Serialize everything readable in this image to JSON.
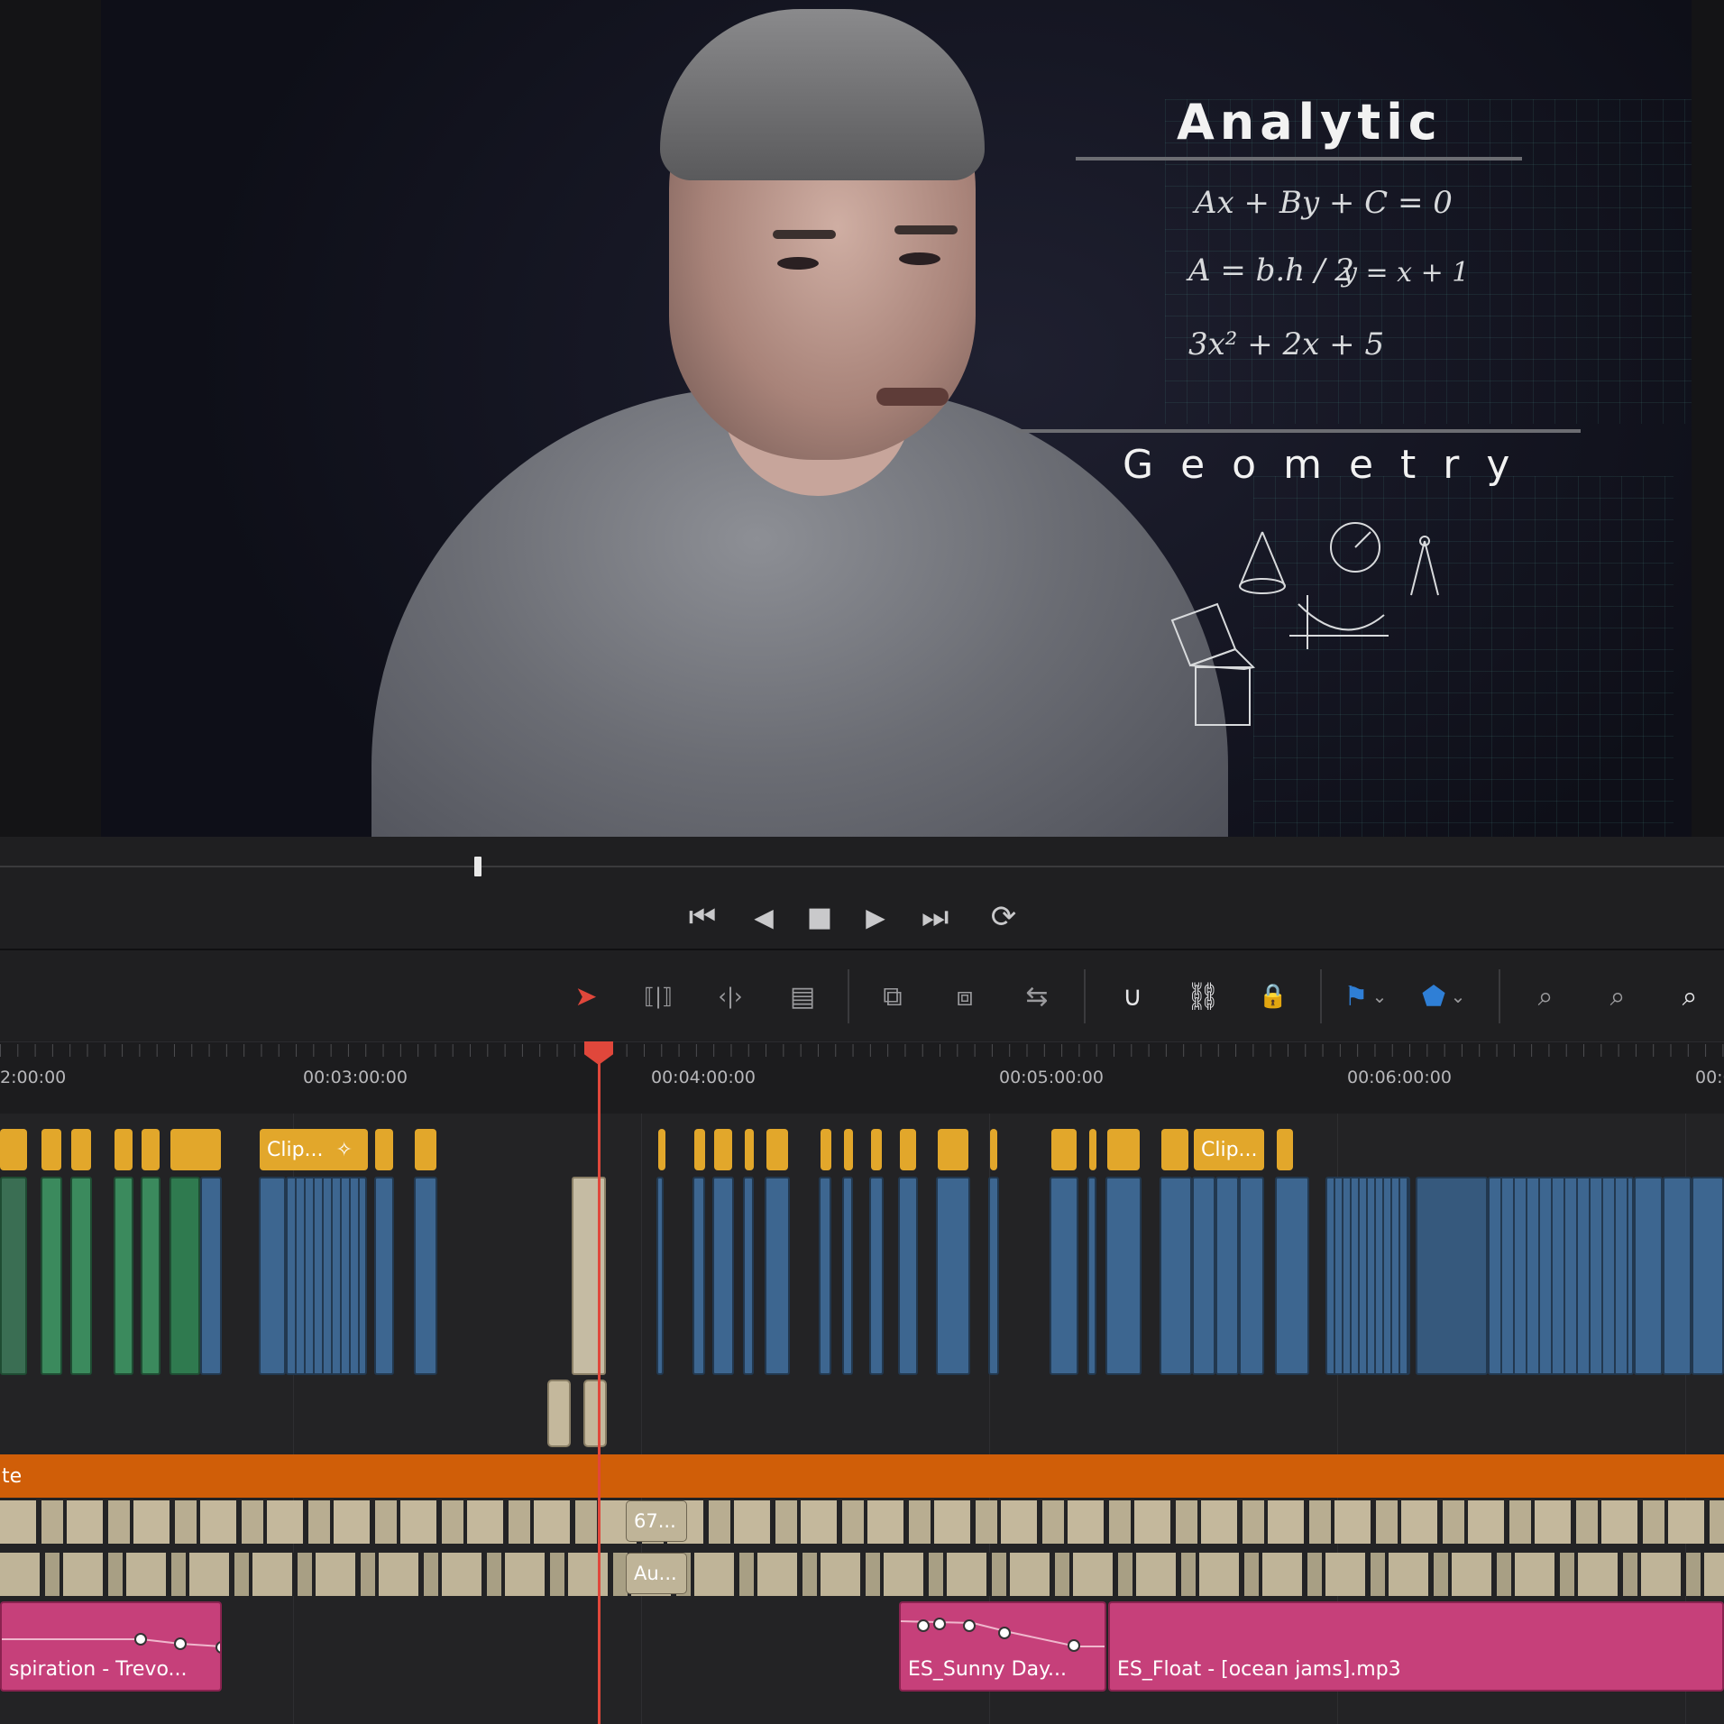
{
  "viewer": {
    "board": {
      "title_top": "Analytic",
      "title_bottom": "Geometry",
      "formulas": [
        "Ax + By + C = 0",
        "A = b.h / 2",
        "y = x + 1",
        "3x² + 2x + 5"
      ]
    }
  },
  "transport": {
    "buttons": [
      {
        "name": "go-to-start",
        "icon": "⏮"
      },
      {
        "name": "play-reverse",
        "icon": "◀"
      },
      {
        "name": "stop",
        "icon": "■"
      },
      {
        "name": "play",
        "icon": "▶"
      },
      {
        "name": "go-to-end",
        "icon": "⏭"
      },
      {
        "name": "loop",
        "icon": "⟳"
      }
    ]
  },
  "toolbar": {
    "tools": [
      {
        "name": "selection-mode",
        "icon": "➤"
      },
      {
        "name": "trim-edit-mode",
        "icon": "⟦|⟧"
      },
      {
        "name": "dynamic-trim-mode",
        "icon": "‹|›"
      },
      {
        "name": "blade-edit-mode",
        "icon": "▤"
      },
      {
        "name": "insert-clip",
        "icon": "⧉"
      },
      {
        "name": "overwrite-clip",
        "icon": "⧈"
      },
      {
        "name": "replace-clip",
        "icon": "⇆"
      },
      {
        "name": "snapping",
        "icon": "∪"
      },
      {
        "name": "linked-selection",
        "icon": "⛓"
      },
      {
        "name": "position-lock",
        "icon": "🔒"
      },
      {
        "name": "flag",
        "icon": "⚑"
      },
      {
        "name": "marker",
        "icon": "⬟"
      },
      {
        "name": "zoom-full",
        "icon": "⌕"
      },
      {
        "name": "zoom-detail",
        "icon": "⌕"
      },
      {
        "name": "zoom-custom",
        "icon": "⌕"
      }
    ],
    "accent_colors": {
      "selection": "#e0473b",
      "flag": "#2f7fd6",
      "marker": "#2f7fd6"
    }
  },
  "ruler": {
    "timecodes": [
      "2:00:00",
      "00:03:00:00",
      "00:04:00:00",
      "00:05:00:00",
      "00:06:00:00",
      "00:0"
    ]
  },
  "timeline": {
    "title_clips": [
      "Clip...",
      "Clip..."
    ],
    "orange_track_label": "te",
    "audio_clip_labels": [
      "67...",
      "Au..."
    ],
    "music_clips": [
      "spiration - Trevo...",
      "ES_Sunny Day...",
      "ES_Float - [ocean jams].mp3"
    ]
  }
}
